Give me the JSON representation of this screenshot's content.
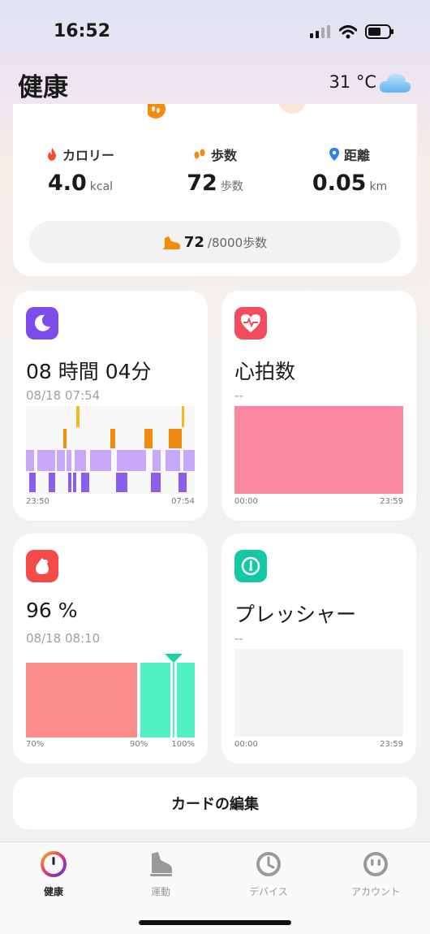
{
  "status": {
    "time": "16:52",
    "icons": [
      "signal-icon",
      "wifi-icon",
      "battery-icon"
    ]
  },
  "header": {
    "title": "健康",
    "temperature": "31 °C",
    "weather_icon": "cloud-icon"
  },
  "summary": {
    "calories": {
      "label": "カロリー",
      "value": "4.0",
      "unit": "kcal",
      "icon": "flame-icon"
    },
    "steps": {
      "label": "歩数",
      "value": "72",
      "unit": "歩数",
      "icon": "footprints-icon"
    },
    "distance": {
      "label": "距離",
      "value": "0.05",
      "unit": "km",
      "icon": "location-pin-icon"
    },
    "progress": {
      "count": "72",
      "goal": "/8000歩数",
      "fraction": 0.009
    }
  },
  "sleep": {
    "value": "08 時間 04分",
    "date": "08/18 07:54",
    "start": "23:50",
    "end": "07:54",
    "icon": "moon-icon",
    "colors": {
      "awake": "#f08a10",
      "light": "#c8a9f7",
      "deep": "#8a5ee8"
    }
  },
  "heart_rate": {
    "title": "心拍数",
    "value": "--",
    "start": "00:00",
    "end": "23:59",
    "icon": "heart-pulse-icon",
    "color": "#fb869f"
  },
  "spo2": {
    "value": "96 %",
    "date": "08/18 08:10",
    "scale": [
      "70%",
      "90%",
      "100%"
    ],
    "icon": "drop-icon",
    "marker_value": 96,
    "colors": {
      "low": "#fb8c8c",
      "normal": "#4ff2c0",
      "marker": "#11d4a0"
    }
  },
  "stress": {
    "title": "プレッシャー",
    "value": "--",
    "start": "00:00",
    "end": "23:59",
    "icon": "gauge-icon"
  },
  "edit_button": "カードの編集",
  "tabs": [
    {
      "label": "健康",
      "icon": "health-ring-icon",
      "active": true
    },
    {
      "label": "運動",
      "icon": "shoe-icon",
      "active": false
    },
    {
      "label": "デバイス",
      "icon": "watch-icon",
      "active": false
    },
    {
      "label": "アカウント",
      "icon": "face-icon",
      "active": false
    }
  ],
  "colors": {
    "accent_red": "#f44a4a",
    "sleep_purple": "#7c4dea",
    "heart_red": "#f24d5d",
    "spo2_red": "#f44a4a",
    "stress_teal": "#14c8a6"
  }
}
